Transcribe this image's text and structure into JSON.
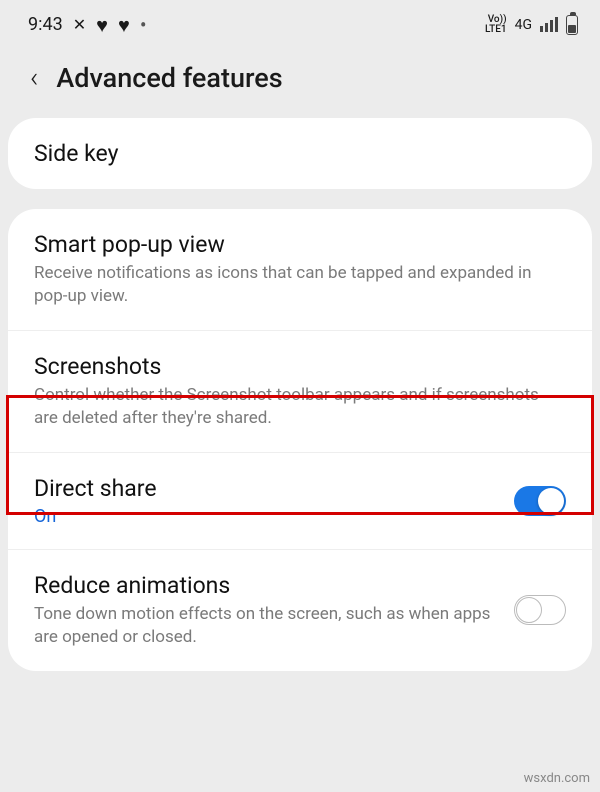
{
  "status": {
    "time": "9:43",
    "lte_top": "Vo))",
    "lte_bottom": "LTE1",
    "net": "4G"
  },
  "header": {
    "title": "Advanced features"
  },
  "side_key": {
    "title": "Side key"
  },
  "items": {
    "smart_popup": {
      "title": "Smart pop-up view",
      "desc": "Receive notifications as icons that can be tapped and expanded in pop-up view."
    },
    "screenshots": {
      "title": "Screenshots",
      "desc": "Control whether the Screenshot toolbar appears and if screenshots are deleted after they're shared."
    },
    "direct_share": {
      "title": "Direct share",
      "status": "On",
      "toggle": true
    },
    "reduce_animations": {
      "title": "Reduce animations",
      "desc": "Tone down motion effects on the screen, such as when apps are opened or closed.",
      "toggle": false
    }
  },
  "watermark": "wsxdn.com"
}
